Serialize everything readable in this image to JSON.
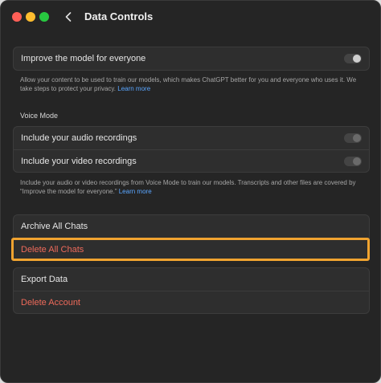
{
  "window": {
    "title": "Data Controls"
  },
  "improve": {
    "label": "Improve the model for everyone",
    "enabled": false,
    "help_text": "Allow your content to be used to train our models, which makes ChatGPT better for you and everyone who uses it. We take steps to protect your privacy.",
    "help_link": "Learn more"
  },
  "voice": {
    "section_title": "Voice Mode",
    "audio_label": "Include your audio recordings",
    "audio_enabled": false,
    "video_label": "Include your video recordings",
    "video_enabled": false,
    "help_text": "Include your audio or video recordings from Voice Mode to train our models. Transcripts and other files are covered by “Improve the model for everyone.”",
    "help_link": "Learn more"
  },
  "chats": {
    "archive_label": "Archive All Chats",
    "delete_label": "Delete All Chats"
  },
  "account": {
    "export_label": "Export Data",
    "delete_account_label": "Delete Account"
  },
  "colors": {
    "background": "#252525",
    "card": "#2e2e2e",
    "danger": "#ee6a5a",
    "link": "#5aa6ff",
    "highlight": "#f0a330"
  },
  "icons": {
    "back": "chevron-left-icon"
  }
}
